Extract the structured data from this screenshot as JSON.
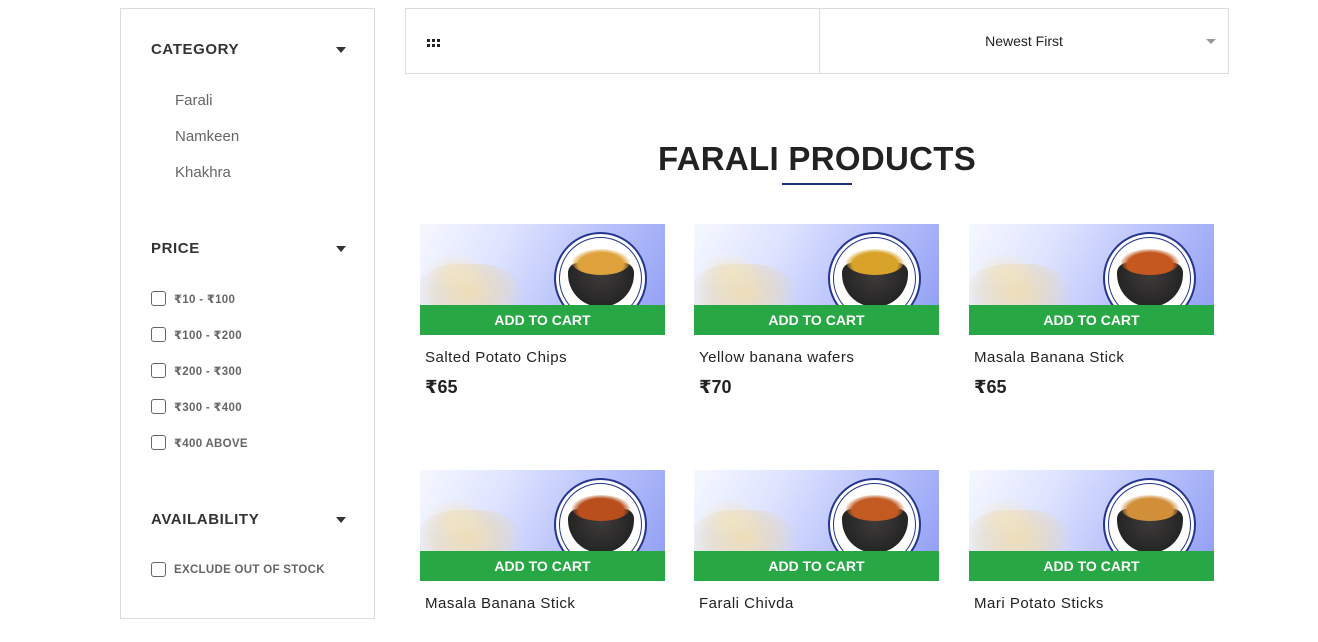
{
  "sidebar": {
    "category": {
      "title": "CATEGORY",
      "items": [
        "Farali",
        "Namkeen",
        "Khakhra"
      ]
    },
    "price": {
      "title": "PRICE",
      "options": [
        "₹10 - ₹100",
        "₹100 - ₹200",
        "₹200 - ₹300",
        "₹300 - ₹400",
        "₹400 ABOVE"
      ]
    },
    "availability": {
      "title": "AVAILABILITY",
      "option": "EXCLUDE OUT OF STOCK"
    }
  },
  "toolbar": {
    "sort_value": "Newest First"
  },
  "main": {
    "heading": "FARALI PRODUCTS",
    "add_to_cart_label": "ADD TO CART",
    "products": [
      {
        "name": "Salted Potato Chips",
        "price": "₹65",
        "snack_color": "#e0a23c"
      },
      {
        "name": "Yellow banana wafers",
        "price": "₹70",
        "snack_color": "#d9a32a"
      },
      {
        "name": "Masala Banana Stick",
        "price": "₹65",
        "snack_color": "#c4581f"
      },
      {
        "name": "Masala Banana Stick",
        "price": "",
        "snack_color": "#b84f1c"
      },
      {
        "name": "Farali Chivda",
        "price": "",
        "snack_color": "#c25a22"
      },
      {
        "name": "Mari Potato Sticks",
        "price": "",
        "snack_color": "#d18f3a"
      }
    ]
  },
  "colors": {
    "accent_green": "#28a745",
    "accent_blue": "#1c2f7c"
  }
}
